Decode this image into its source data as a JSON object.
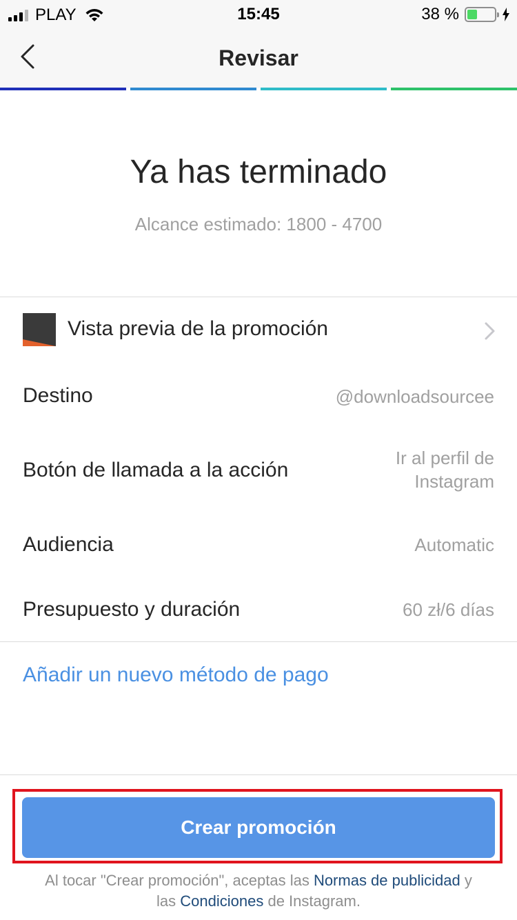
{
  "status_bar": {
    "carrier": "PLAY",
    "time": "15:45",
    "battery_percent": "38 %",
    "battery_level": 0.38
  },
  "nav": {
    "title": "Revisar"
  },
  "progress": {
    "segments": [
      "#1f2fb8",
      "#2f8ad0",
      "#2fbcc8",
      "#2ec26a"
    ]
  },
  "hero": {
    "title": "Ya has terminado",
    "subtitle": "Alcance estimado: 1800 - 4700"
  },
  "rows": {
    "preview": {
      "label": "Vista previa de la promoción"
    },
    "destination": {
      "label": "Destino",
      "value": "@downloadsourcee"
    },
    "cta_button": {
      "label": "Botón de llamada a la acción",
      "value_line1": "Ir al perfil de",
      "value_line2": "Instagram"
    },
    "audience": {
      "label": "Audiencia",
      "value": "Automatic"
    },
    "budget": {
      "label": "Presupuesto y duración",
      "value": "60 zł/6 días"
    }
  },
  "payment_link": "Añadir un nuevo método de pago",
  "create_button": "Crear promoción",
  "footer": {
    "part1": "Al tocar \"Crear promoción\", aceptas las ",
    "link1": "Normas de publicidad",
    "part2": " y las ",
    "link2": "Condiciones",
    "part3": " de Instagram."
  },
  "colors": {
    "accent": "#5795e6",
    "link": "#4a90e2",
    "highlight": "#e0141e"
  }
}
